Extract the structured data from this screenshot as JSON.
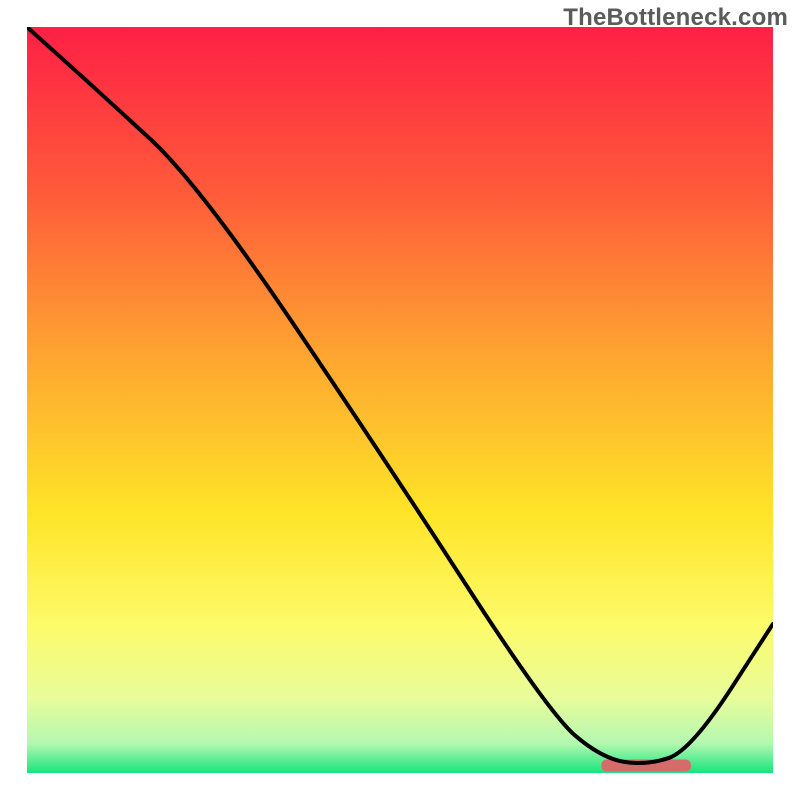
{
  "watermark": "TheBottleneck.com",
  "chart_data": {
    "type": "line",
    "title": "",
    "xlabel": "",
    "ylabel": "",
    "xlim": [
      0,
      100
    ],
    "ylim": [
      0,
      100
    ],
    "grid": false,
    "background_gradient": {
      "stops": [
        {
          "offset": 0.0,
          "color": "#fe2045"
        },
        {
          "offset": 0.22,
          "color": "#fe5a3a"
        },
        {
          "offset": 0.45,
          "color": "#fea830"
        },
        {
          "offset": 0.65,
          "color": "#fee427"
        },
        {
          "offset": 0.8,
          "color": "#fdfb69"
        },
        {
          "offset": 0.9,
          "color": "#e8fc9a"
        },
        {
          "offset": 0.96,
          "color": "#b4f8b0"
        },
        {
          "offset": 1.0,
          "color": "#18e47c"
        }
      ]
    },
    "series": [
      {
        "name": "bottleneck-curve",
        "color": "#000000",
        "x": [
          0,
          10,
          23,
          48,
          70,
          77,
          83,
          89,
          100
        ],
        "y": [
          100,
          91,
          79,
          42,
          8,
          2,
          1,
          3,
          20
        ]
      }
    ],
    "target_marker": {
      "x_start": 77,
      "x_end": 89,
      "y": 1,
      "color": "#d66b6b"
    }
  }
}
